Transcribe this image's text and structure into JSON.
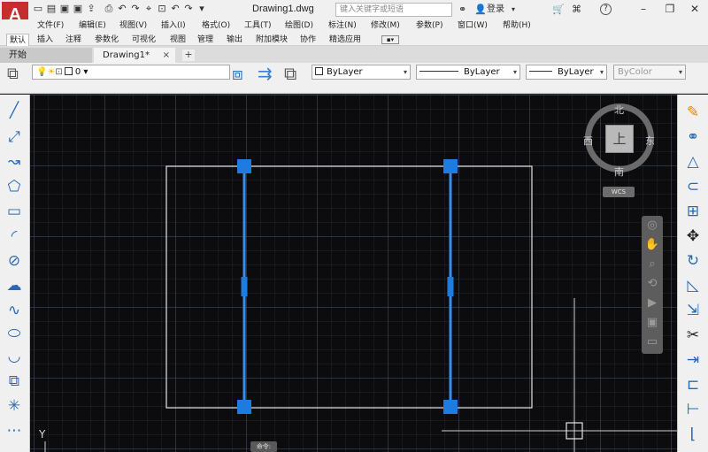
{
  "app": {
    "logo_letter": "A",
    "document_title": "Drawing1.dwg",
    "search_placeholder": "键入关键字或短语",
    "login_label": "登录",
    "help_icon": "?"
  },
  "menu": [
    "文件(F)",
    "编辑(E)",
    "视图(V)",
    "插入(I)",
    "格式(O)",
    "工具(T)",
    "绘图(D)",
    "标注(N)",
    "修改(M)",
    "参数(P)",
    "窗口(W)",
    "帮助(H)"
  ],
  "ribbon_tabs": [
    "默认",
    "插入",
    "注释",
    "参数化",
    "可视化",
    "视图",
    "管理",
    "输出",
    "附加模块",
    "协作",
    "精选应用"
  ],
  "document_tabs": [
    {
      "label": "开始"
    },
    {
      "label": "Drawing1*",
      "close": "×"
    }
  ],
  "add_tab_icon": "+",
  "layer_toolbar": {
    "current_layer": "0",
    "color": "ByLayer",
    "linetype": "ByLayer",
    "lineweight": "ByLayer",
    "plot_style": "ByColor"
  },
  "viewcube": {
    "top_face": "上",
    "north": "北",
    "south": "南",
    "east": "东",
    "west": "西",
    "ucs_label": "WCS"
  },
  "command_label": "命令:",
  "ucs_axis_label": "Y",
  "colors": {
    "canvas_bg": "#0c0c0e",
    "grip_blue": "#1e7be0",
    "rect_line": "#e6e6e6",
    "selected_line": "#3a8eea",
    "logo_red": "#c62d2d"
  },
  "drawing": {
    "objects": [
      {
        "type": "rectangle",
        "selected": false
      },
      {
        "type": "line",
        "selected": true,
        "grips": 3
      },
      {
        "type": "line",
        "selected": true,
        "grips": 3
      }
    ]
  }
}
